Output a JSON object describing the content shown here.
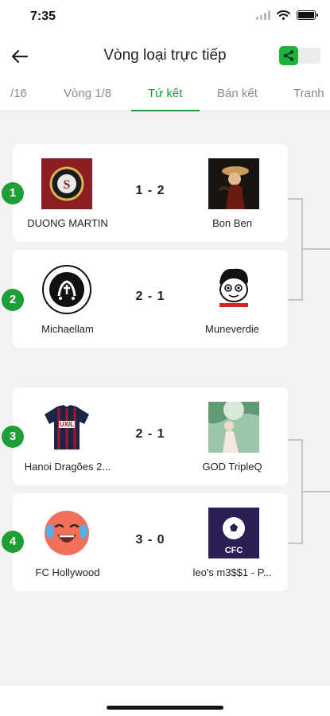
{
  "status_bar": {
    "time": "7:35"
  },
  "nav": {
    "title": "Vòng loại trực tiếp"
  },
  "tabs": [
    {
      "label": "/16",
      "active": false
    },
    {
      "label": "Vòng 1/8",
      "active": false
    },
    {
      "label": "Tứ kết",
      "active": true
    },
    {
      "label": "Bán kết",
      "active": false
    },
    {
      "label": "Tranh",
      "active": false
    }
  ],
  "matches": [
    {
      "number": "1",
      "home": "DUONG MARTIN",
      "score": "1 - 2",
      "away": "Bon Ben",
      "home_logo": "sparta-crest-icon",
      "away_logo": "player-photo-icon"
    },
    {
      "number": "2",
      "home": "Michaellam",
      "score": "2 - 1",
      "away": "Muneverdie",
      "home_logo": "chelsea-crest-icon",
      "away_logo": "cartoon-face-icon"
    },
    {
      "number": "3",
      "home": "Hanoi Dragões 2...",
      "score": "2 - 1",
      "away": "GOD TripleQ",
      "home_logo": "jersey-icon",
      "away_logo": "person-photo-icon"
    },
    {
      "number": "4",
      "home": "FC Hollywood",
      "score": "3 - 0",
      "away": "leo's m3$$1 - P...",
      "home_logo": "laughing-emoji-icon",
      "away_logo": "cfc-soccer-ball-icon"
    }
  ],
  "colors": {
    "accent": "#1a9e3b",
    "badge": "#1e9e36",
    "background": "#f2f2f2"
  }
}
